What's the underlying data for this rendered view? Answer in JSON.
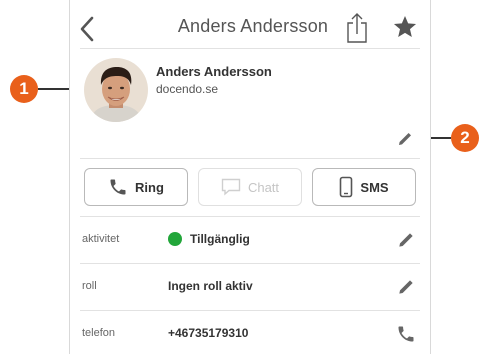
{
  "header": {
    "title": "Anders Andersson",
    "back_icon": "chevron-left-icon",
    "share_icon": "share-icon",
    "favorite_icon": "star-icon"
  },
  "profile": {
    "name": "Anders Andersson",
    "company": "docendo.se",
    "avatar_icon": "avatar-photo"
  },
  "actions": {
    "ring_label": "Ring",
    "chat_label": "Chatt",
    "sms_label": "SMS"
  },
  "rows": [
    {
      "label": "aktivitet",
      "value": "Tillgänglig",
      "status_color": "#22a63a",
      "action_icon": "pencil-icon"
    },
    {
      "label": "roll",
      "value": "Ingen roll aktiv",
      "action_icon": "pencil-icon"
    },
    {
      "label": "telefon",
      "value": "+46735179310",
      "action_icon": "phone-icon"
    }
  ],
  "callouts": {
    "one": "1",
    "two": "2",
    "color": "#e9601b"
  }
}
